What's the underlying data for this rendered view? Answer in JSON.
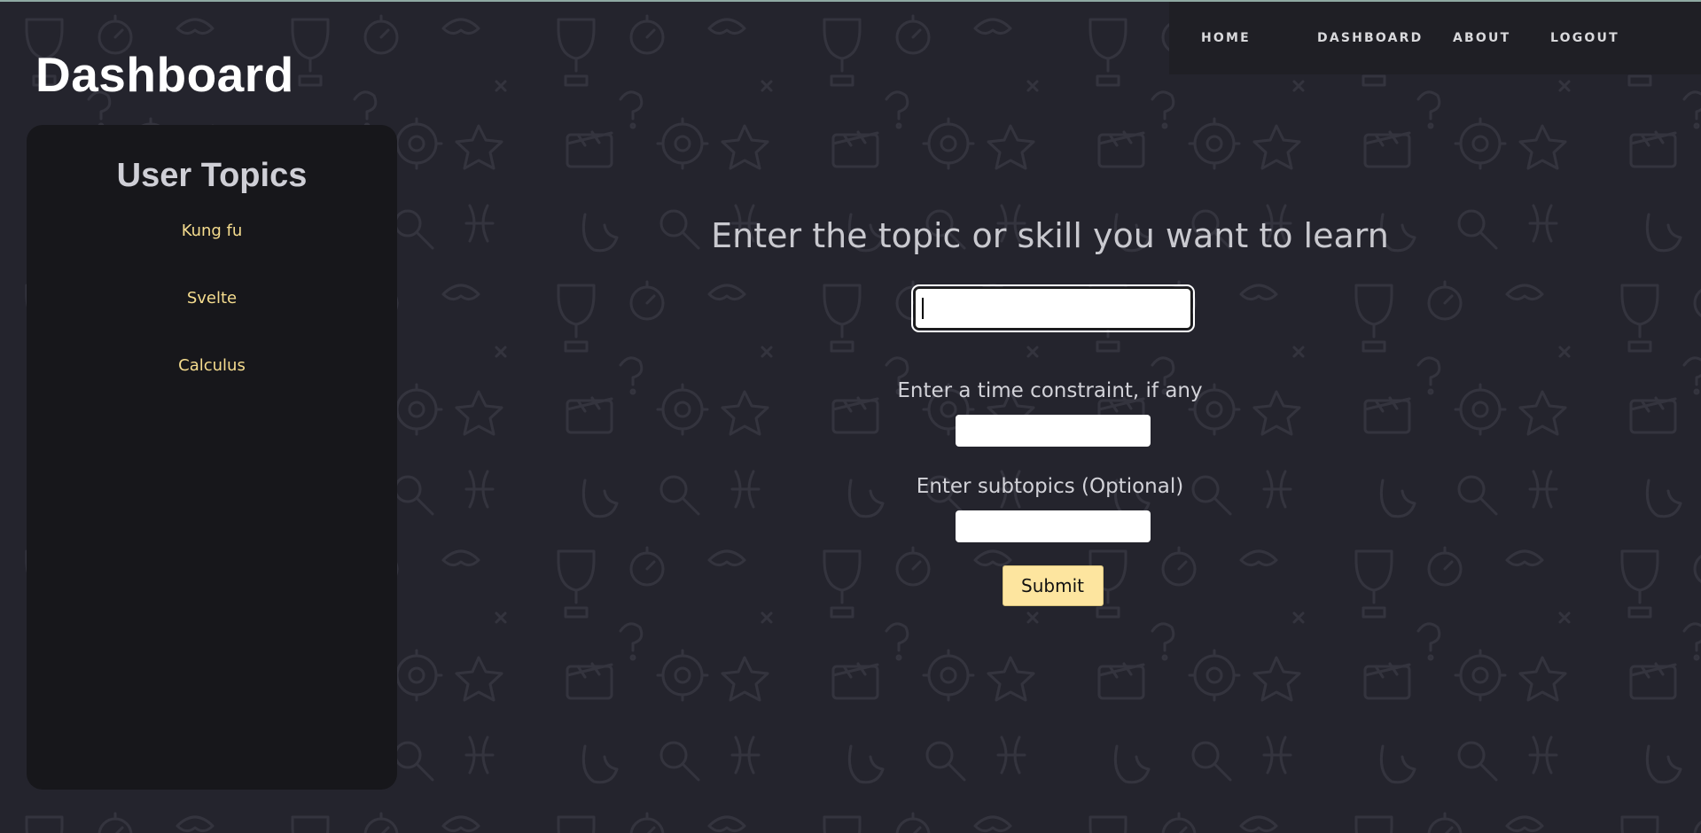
{
  "nav": {
    "items": [
      "HOME",
      "DASHBOARD",
      "ABOUT",
      "LOGOUT"
    ]
  },
  "page": {
    "title": "Dashboard"
  },
  "sidebar": {
    "title": "User Topics",
    "topics": [
      "Kung fu",
      "Svelte",
      "Calculus"
    ]
  },
  "form": {
    "heading": "Enter the topic or skill you want to learn",
    "topic_value": "",
    "time_label": "Enter a time constraint, if any",
    "time_value": "",
    "subtopics_label": "Enter subtopics (Optional)",
    "subtopics_value": "",
    "submit_label": "Submit"
  },
  "colors": {
    "background": "#24242d",
    "navbar": "#1f1f25",
    "sidebar": "#17171b",
    "topic_text": "#f6dd8f",
    "submit_button": "#fde59f"
  }
}
